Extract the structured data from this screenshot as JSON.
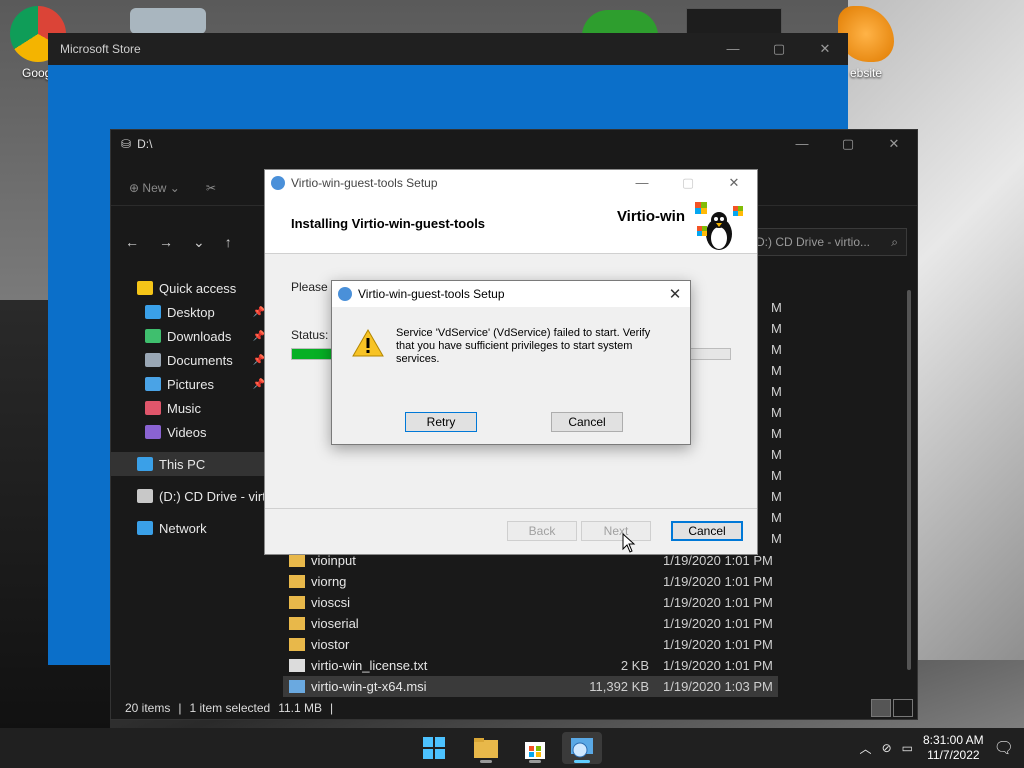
{
  "desktop": {
    "icons": [
      {
        "label": "Googl",
        "name": "google-chrome"
      },
      {
        "label": "ebsite",
        "name": "website"
      }
    ]
  },
  "store_window": {
    "title": "Microsoft Store",
    "controls": [
      "—",
      "▢",
      "✕"
    ]
  },
  "explorer": {
    "title": "D:\\",
    "toolbar": {
      "new_label": "New",
      "cut_icon": "scissors-icon"
    },
    "search_placeholder": "D:) CD Drive - virtio...",
    "sidebar": [
      {
        "label": "Quick access",
        "icon": "star-icon",
        "color": "#f5c518",
        "indent": 0,
        "pinned": false
      },
      {
        "label": "Desktop",
        "icon": "desktop-icon",
        "color": "#3aa0e8",
        "indent": 1,
        "pinned": true
      },
      {
        "label": "Downloads",
        "icon": "download-icon",
        "color": "#3fbf6e",
        "indent": 1,
        "pinned": true
      },
      {
        "label": "Documents",
        "icon": "document-icon",
        "color": "#9aa7b5",
        "indent": 1,
        "pinned": true
      },
      {
        "label": "Pictures",
        "icon": "pictures-icon",
        "color": "#4aa3e6",
        "indent": 1,
        "pinned": true
      },
      {
        "label": "Music",
        "icon": "music-icon",
        "color": "#e0566b",
        "indent": 1,
        "pinned": false
      },
      {
        "label": "Videos",
        "icon": "videos-icon",
        "color": "#8a63d2",
        "indent": 1,
        "pinned": false
      },
      {
        "label": "This PC",
        "icon": "pc-icon",
        "color": "#3aa0e8",
        "indent": 0,
        "pinned": false,
        "selected": true
      },
      {
        "label": "(D:) CD Drive - virti",
        "icon": "cd-drive-icon",
        "color": "#c8c8c8",
        "indent": 0,
        "pinned": false
      },
      {
        "label": "Network",
        "icon": "network-icon",
        "color": "#3aa0e8",
        "indent": 0,
        "pinned": false
      }
    ],
    "right_col_times": [
      "M",
      "M",
      "M",
      "M",
      "M",
      "M",
      "M",
      "M",
      "M",
      "M",
      "M",
      "M"
    ],
    "files": [
      {
        "name": "vioinput",
        "type": "folder",
        "size": "",
        "date": "1/19/2020 1:01 PM"
      },
      {
        "name": "viorng",
        "type": "folder",
        "size": "",
        "date": "1/19/2020 1:01 PM"
      },
      {
        "name": "vioscsi",
        "type": "folder",
        "size": "",
        "date": "1/19/2020 1:01 PM"
      },
      {
        "name": "vioserial",
        "type": "folder",
        "size": "",
        "date": "1/19/2020 1:01 PM"
      },
      {
        "name": "viostor",
        "type": "folder",
        "size": "",
        "date": "1/19/2020 1:01 PM"
      },
      {
        "name": "virtio-win_license.txt",
        "type": "text",
        "size": "2 KB",
        "date": "1/19/2020 1:01 PM"
      },
      {
        "name": "virtio-win-gt-x64.msi",
        "type": "msi",
        "size": "11,392 KB",
        "date": "1/19/2020 1:03 PM",
        "selected": true
      }
    ],
    "status": {
      "items": "20 items",
      "selected": "1 item selected",
      "size": "11.1 MB"
    }
  },
  "setup": {
    "title": "Virtio-win-guest-tools Setup",
    "heading": "Installing Virtio-win-guest-tools",
    "brand": "Virtio-win",
    "please_text": "Please w",
    "status_label": "Status:",
    "progress_fraction": 0.1,
    "buttons": {
      "back": "Back",
      "next": "Next",
      "cancel": "Cancel"
    }
  },
  "dialog": {
    "title": "Virtio-win-guest-tools Setup",
    "message": "Service 'VdService' (VdService) failed to start.  Verify that you have sufficient privileges to start system services.",
    "retry": "Retry",
    "cancel": "Cancel"
  },
  "taskbar": {
    "apps": [
      {
        "name": "start",
        "icon": "windows-icon",
        "active": false
      },
      {
        "name": "file-explorer",
        "icon": "folder-icon",
        "active": false
      },
      {
        "name": "microsoft-store",
        "icon": "store-icon",
        "active": false
      },
      {
        "name": "setup",
        "icon": "installer-icon",
        "active": true
      }
    ],
    "time": "8:31:00 AM",
    "date": "11/7/2022"
  },
  "colors": {
    "accent": "#0078d7",
    "progress": "#06b025",
    "store_blue": "#0b6fc9"
  }
}
